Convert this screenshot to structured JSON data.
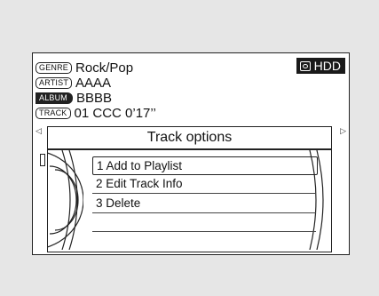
{
  "track_info": {
    "genre": {
      "tag": "GENRE",
      "value": "Rock/Pop"
    },
    "artist": {
      "tag": "ARTIST",
      "value": "AAAA"
    },
    "album": {
      "tag": "ALBUM",
      "value": "BBBB"
    },
    "track": {
      "tag": "TRACK",
      "value": "01 CCC  0’17’’"
    }
  },
  "source_badge": {
    "label": "HDD",
    "icon": "hdd-icon"
  },
  "track_options": {
    "title": "Track options",
    "items": [
      {
        "label": "1 Add to Playlist",
        "selected": true
      },
      {
        "label": "2 Edit Track Info",
        "selected": false
      },
      {
        "label": "3 Delete",
        "selected": false
      }
    ]
  },
  "colors": {
    "background": "#e6e6e6",
    "screen": "#ffffff",
    "ink": "#222222"
  }
}
